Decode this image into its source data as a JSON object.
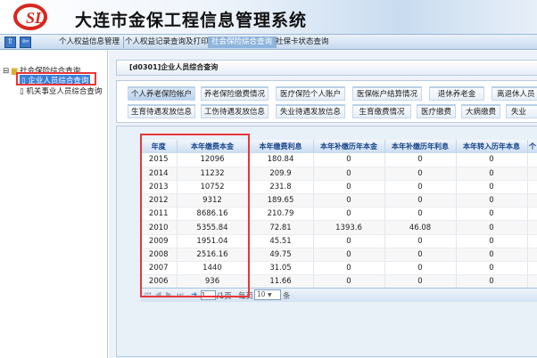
{
  "app": {
    "title": "大连市金保工程信息管理系统",
    "logo_text": "SL",
    "brand_color": "#d9261c"
  },
  "nav": {
    "items": [
      "个人权益信息管理",
      "个人权益记录查询及打印",
      "社会保险综合查询",
      "社保卡状态查询"
    ],
    "active": 2
  },
  "sidebar": {
    "root": "社会保险综合查询",
    "children": [
      "企业人员综合查询",
      "机关事业人员综合查询"
    ],
    "selected": 0
  },
  "panel": {
    "title": "[d0301]企业人员综合查询"
  },
  "tabs": {
    "row1": [
      "个人养老保险帐户",
      "养老保险缴费情况",
      "医疗保险个人账户",
      "医保帐户结算情况",
      "退休养老金",
      "离退休人员"
    ],
    "row2": [
      "生育待遇发放信息",
      "工伤待遇发放信息",
      "失业待遇发放信息",
      "生育缴费情况",
      "医疗缴费",
      "大病缴费",
      "失业"
    ],
    "active": "个人养老保险帐户"
  },
  "table": {
    "columns": [
      "年度",
      "本年缴费本金",
      "本年缴费利息",
      "本年补缴历年本金",
      "本年补缴历年利息",
      "本年转入历年本息",
      "个"
    ],
    "rows": [
      [
        "2015",
        "12096",
        "180.84",
        "0",
        "0",
        "0"
      ],
      [
        "2014",
        "11232",
        "209.9",
        "0",
        "0",
        "0"
      ],
      [
        "2013",
        "10752",
        "231.8",
        "0",
        "0",
        "0"
      ],
      [
        "2012",
        "9312",
        "189.65",
        "0",
        "0",
        "0"
      ],
      [
        "2011",
        "8686.16",
        "210.79",
        "0",
        "0",
        "0"
      ],
      [
        "2010",
        "5355.84",
        "72.81",
        "1393.6",
        "46.08",
        "0"
      ],
      [
        "2009",
        "1951.04",
        "45.51",
        "0",
        "0",
        "0"
      ],
      [
        "2008",
        "2516.16",
        "49.75",
        "0",
        "0",
        "0"
      ],
      [
        "2007",
        "1440",
        "31.05",
        "0",
        "0",
        "0"
      ],
      [
        "2006",
        "936",
        "11.66",
        "0",
        "0",
        "0"
      ]
    ]
  },
  "pager": {
    "page": "1",
    "total_label": "/1页",
    "per_page_label": "每页",
    "per_page": "10",
    "unit": "条",
    "first_icon": "first-page-icon",
    "prev_icon": "prev-page-icon",
    "next_icon": "next-page-icon",
    "last_icon": "last-page-icon"
  },
  "highlight_color": "#e8363a"
}
